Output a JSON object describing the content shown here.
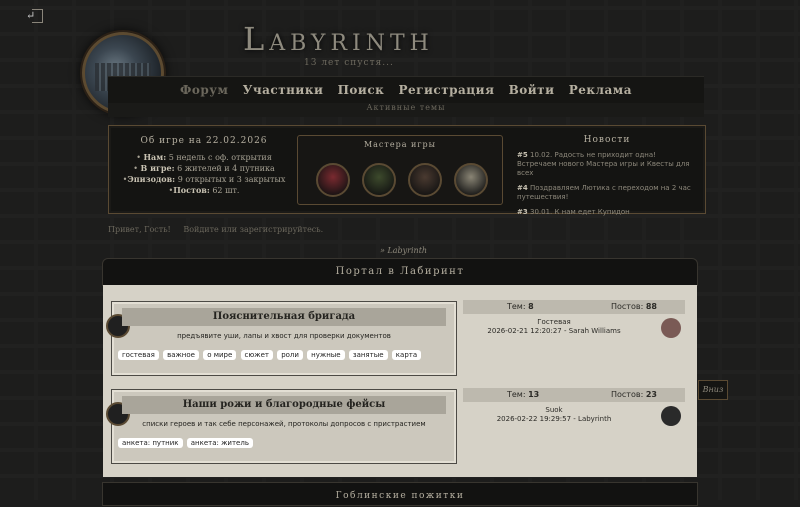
{
  "header": {
    "title": "Labyrinth",
    "subtitle": "13 лет спустя..."
  },
  "nav": {
    "items": [
      "Форум",
      "Участники",
      "Поиск",
      "Регистрация",
      "Войти",
      "Реклама"
    ],
    "active": "Форум",
    "sub": "Активные темы"
  },
  "about": {
    "heading": "Об игре на 22.02.2026",
    "lines": [
      {
        "label": "Нам:",
        "value": "5 недель с оф. открытия"
      },
      {
        "label": "В игре:",
        "value": "6 жителей и 4 путника"
      },
      {
        "label": "Эпизодов:",
        "value": "9 открытых и 3 закрытых"
      },
      {
        "label": "Постов:",
        "value": "62 шт."
      }
    ]
  },
  "masters": {
    "heading": "Мастера игры",
    "avatars": [
      "#7a2a30",
      "#3d4a2c",
      "#4a3a30",
      "#8a8575"
    ]
  },
  "news": {
    "heading": "Новости",
    "items": [
      {
        "num": "#5",
        "date": "10.02.",
        "text": "Радость не приходит одна! Встречаем нового Мастера игры и Квесты для всех"
      },
      {
        "num": "#4",
        "date": "",
        "text": "Поздравляем Лютика с переходом на 2 час путешествия!"
      },
      {
        "num": "#3",
        "date": "30.01.",
        "text": "К нам едет Купидон"
      }
    ]
  },
  "greeting": {
    "hello": "Привет, Гость!",
    "login": "Войдите или зарегистрируйтесь."
  },
  "breadcrumb": "» Labyrinth",
  "portal": {
    "title": "Портал в Лабиринт"
  },
  "forums": [
    {
      "title": "Пояснительная бригада",
      "desc": "предъявите уши, лапы и хвост для проверки документов",
      "tags": [
        "гостевая",
        "важное",
        "о мире",
        "сюжет",
        "роли",
        "нужные",
        "занятые",
        "карта"
      ],
      "topics_label": "Тем:",
      "topics": "8",
      "posts_label": "Постов:",
      "posts": "88",
      "last_topic": "Гостевая",
      "last_meta": "2026-02-21 12:20:27 - Sarah Williams",
      "avatar_color": "#7a5a55"
    },
    {
      "title": "Наши рожи и благородные фейсы",
      "desc": "списки героев и так себе персонажей, протоколы допросов с пристрастием",
      "tags": [
        "анкета: путник",
        "анкета: житель"
      ],
      "topics_label": "Тем:",
      "topics": "13",
      "posts_label": "Постов:",
      "posts": "23",
      "last_topic": "Suok",
      "last_meta": "2026-02-22 19:29:57 - Labyrinth",
      "avatar_color": "#2a2a2a"
    }
  ],
  "down_button": "Вниз",
  "next_section": "Гоблинские пожитки",
  "colors": {
    "accent": "#5a4a33",
    "panel": "#141412",
    "content": "#d6d2c7"
  }
}
